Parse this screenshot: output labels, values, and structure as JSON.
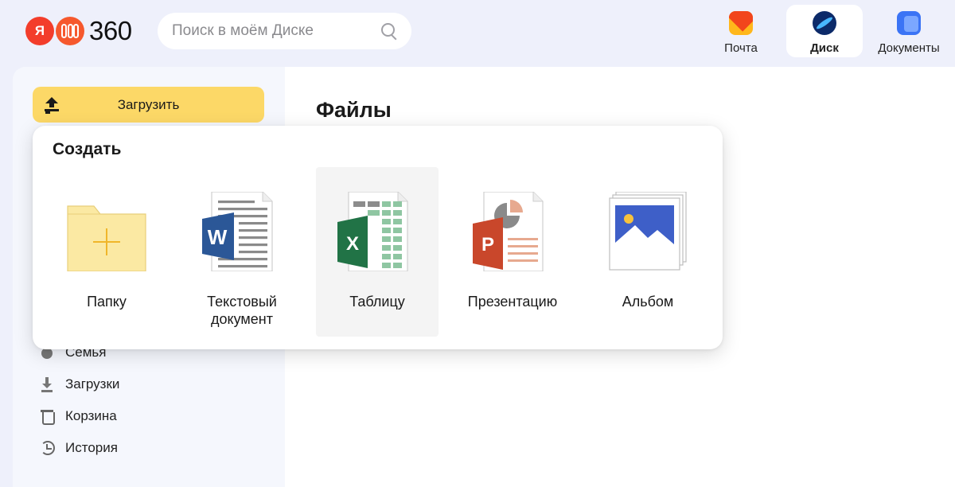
{
  "header": {
    "logo": {
      "mark": "Я",
      "text": "360"
    },
    "search": {
      "placeholder": "Поиск в моём Диске",
      "icon": "search-icon"
    },
    "apps": [
      {
        "label": "Почта",
        "icon": "mail-icon",
        "active": false
      },
      {
        "label": "Диск",
        "icon": "disk-icon",
        "active": true
      },
      {
        "label": "Документы",
        "icon": "docs-icon",
        "active": false
      }
    ]
  },
  "sidebar": {
    "upload_label": "Загрузить",
    "items": [
      {
        "label": "Семья",
        "icon": "family-icon"
      },
      {
        "label": "Загрузки",
        "icon": "download-icon"
      },
      {
        "label": "Корзина",
        "icon": "trash-icon"
      },
      {
        "label": "История",
        "icon": "history-icon"
      }
    ]
  },
  "main": {
    "title": "Файлы"
  },
  "create_popup": {
    "title": "Создать",
    "items": [
      {
        "label": "Папку",
        "icon": "folder-icon"
      },
      {
        "label": "Текстовый документ",
        "icon": "word-document-icon"
      },
      {
        "label": "Таблицу",
        "icon": "excel-spreadsheet-icon",
        "hovered": true
      },
      {
        "label": "Презентацию",
        "icon": "powerpoint-presentation-icon"
      },
      {
        "label": "Альбом",
        "icon": "photo-album-icon"
      }
    ]
  },
  "colors": {
    "upload_button": "#fcd867",
    "word_blue": "#2b5797",
    "excel_green": "#217346",
    "powerpoint_orange": "#c9472b",
    "album_blue": "#3e5fc8"
  }
}
